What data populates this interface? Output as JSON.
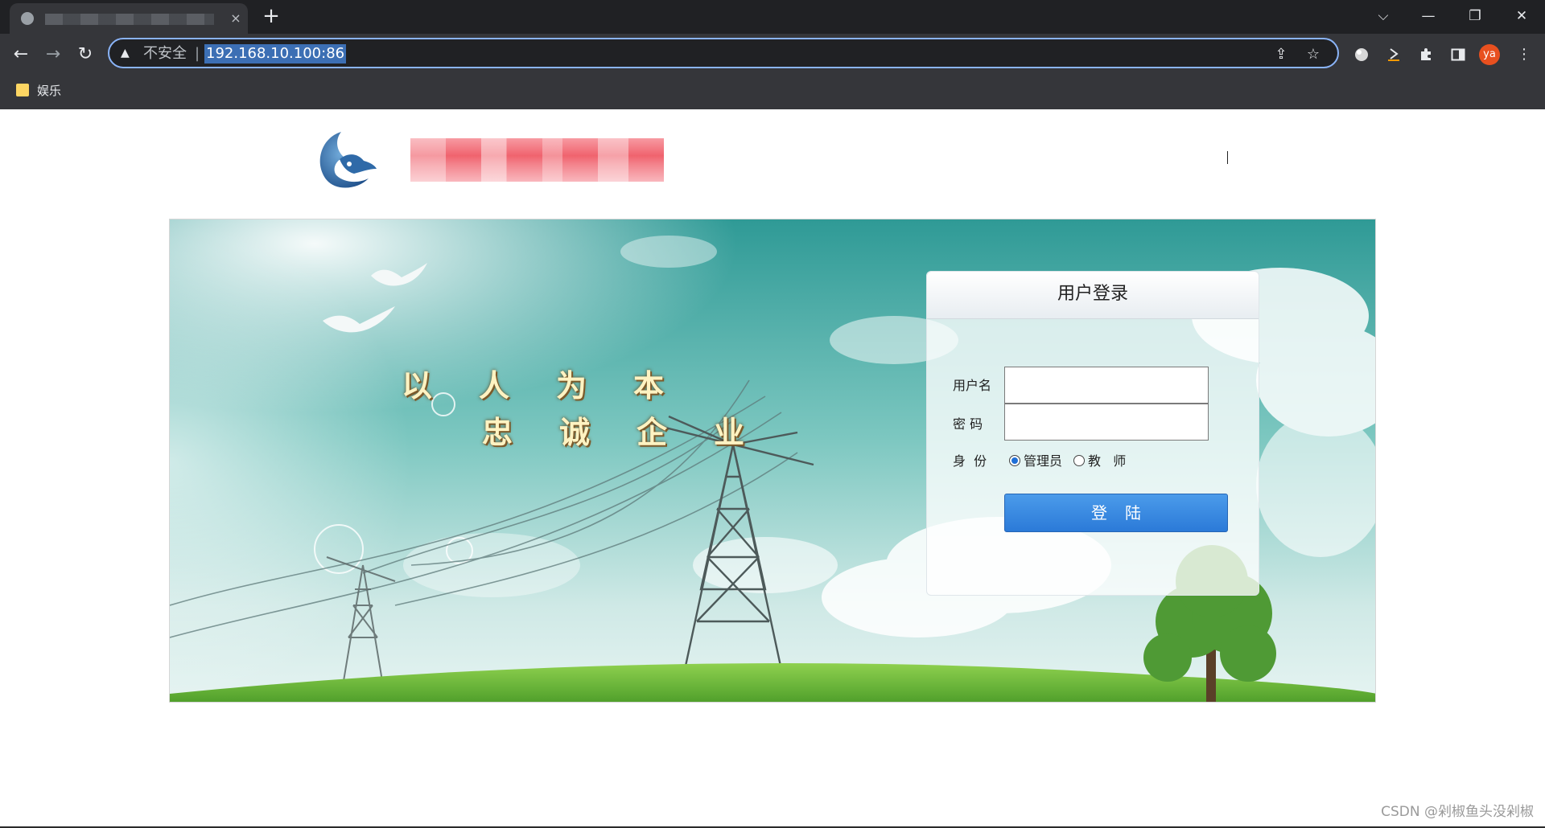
{
  "browser": {
    "tab": {
      "close_icon": "×"
    },
    "new_tab_icon": "+",
    "window_controls": {
      "dropdown": "⌵",
      "minimize": "—",
      "restore": "❐",
      "close": "✕"
    },
    "nav": {
      "back": "←",
      "forward": "→",
      "reload": "↻"
    },
    "omnibox": {
      "security_icon": "▲",
      "security_text": "不安全",
      "separator": "|",
      "url": "192.168.10.100:86",
      "share_icon": "⇪",
      "star_icon": "☆"
    },
    "profile": {
      "initials": "ya"
    },
    "menu_icon": "⋮",
    "bookmarks": [
      {
        "label": "娱乐"
      }
    ]
  },
  "page": {
    "slogan": {
      "line1": "以人为本",
      "line2": "忠诚企业"
    },
    "login": {
      "title": "用户登录",
      "username_label": "用户名",
      "password_label": "密 码",
      "role_label": "身  份",
      "role_options": [
        {
          "label": "管理员",
          "checked": true
        },
        {
          "label": "教   师",
          "checked": false
        }
      ],
      "submit_label": "登陆"
    },
    "watermark": "CSDN @剁椒鱼头没剁椒"
  }
}
